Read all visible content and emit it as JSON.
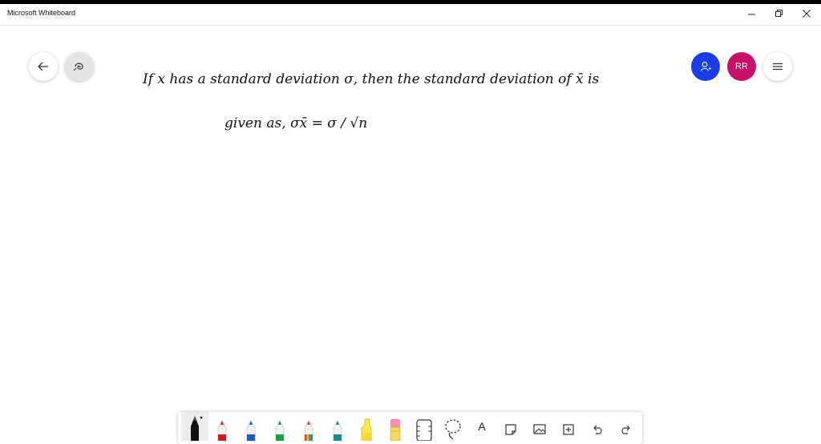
{
  "window": {
    "title": "Microsoft Whiteboard"
  },
  "header": {
    "user_initials": "RR",
    "colors": {
      "invite": "#1b3de8",
      "avatar": "#c7106a"
    }
  },
  "canvas": {
    "ink_lines": [
      "If x has a standard deviation σ, then the standard deviation of x̄ is",
      "given as, σx̄ = σ / √n"
    ]
  },
  "toolbar": {
    "tools": [
      "pen-black",
      "pen-red",
      "pen-blue",
      "pen-green",
      "pen-rainbow",
      "pen-galaxy",
      "highlighter",
      "eraser",
      "ruler",
      "lasso",
      "text",
      "sticky-note",
      "image",
      "insert",
      "undo",
      "redo"
    ],
    "text_tool_label": "A"
  }
}
